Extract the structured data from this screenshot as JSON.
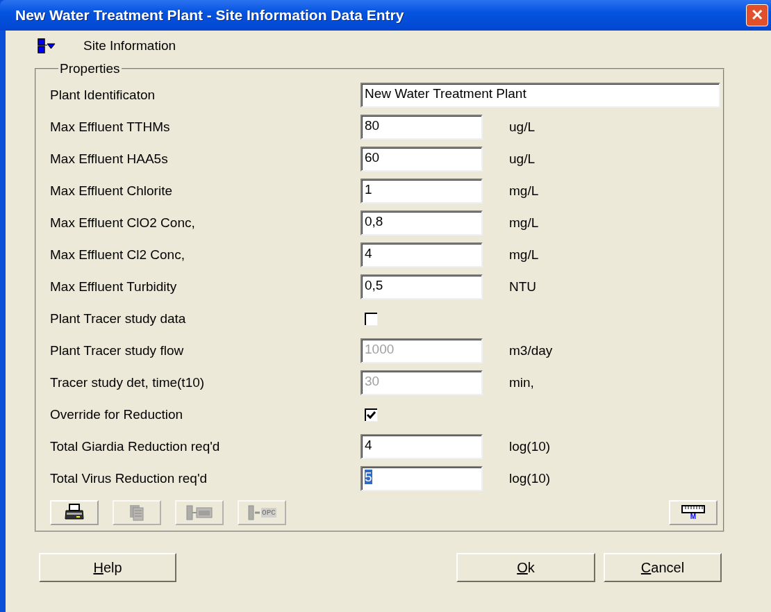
{
  "window": {
    "title": "New Water Treatment Plant - Site Information Data Entry",
    "close": "✕"
  },
  "header": {
    "label": "Site Information"
  },
  "group": {
    "title": "Properties"
  },
  "rows": [
    {
      "kind": "text",
      "label": "Plant Identificaton",
      "value": "New Water Treatment Plant",
      "disabled": false,
      "highlighted": false
    },
    {
      "kind": "text",
      "label": "Max Effluent TTHMs",
      "value": "80",
      "unit": "ug/L",
      "disabled": false,
      "highlighted": false
    },
    {
      "kind": "text",
      "label": "Max Effluent HAA5s",
      "value": "60",
      "unit": "ug/L",
      "disabled": false,
      "highlighted": false
    },
    {
      "kind": "text",
      "label": "Max Effluent Chlorite",
      "value": "1",
      "unit": "mg/L",
      "disabled": false,
      "highlighted": false
    },
    {
      "kind": "text",
      "label": "Max Effluent ClO2 Conc,",
      "value": "0,8",
      "unit": "mg/L",
      "disabled": false,
      "highlighted": false
    },
    {
      "kind": "text",
      "label": "Max Effluent Cl2 Conc,",
      "value": "4",
      "unit": "mg/L",
      "disabled": false,
      "highlighted": false
    },
    {
      "kind": "text",
      "label": "Max Effluent Turbidity",
      "value": "0,5",
      "unit": "NTU",
      "disabled": false,
      "highlighted": false
    },
    {
      "kind": "checkbox",
      "label": "Plant Tracer study data",
      "checked": false
    },
    {
      "kind": "text",
      "label": "Plant Tracer study flow",
      "value": "1000",
      "unit": "m3/day",
      "disabled": true,
      "highlighted": false
    },
    {
      "kind": "text",
      "label": "Tracer study det, time(t10)",
      "value": "30",
      "unit": "min,",
      "disabled": true,
      "highlighted": false
    },
    {
      "kind": "checkbox",
      "label": "Override for Reduction",
      "checked": true
    },
    {
      "kind": "text",
      "label": "Total Giardia Reduction req'd",
      "value": "4",
      "unit": "log(10)",
      "disabled": false,
      "highlighted": false
    },
    {
      "kind": "text",
      "label": "Total Virus Reduction req'd",
      "value": "5",
      "unit": "log(10)",
      "disabled": false,
      "highlighted": true
    }
  ],
  "toolbar": [
    {
      "kind": "print",
      "disabled": false
    },
    {
      "kind": "copy",
      "disabled": true
    },
    {
      "kind": "layout",
      "disabled": true
    },
    {
      "kind": "export",
      "label": "OPC",
      "disabled": true
    }
  ],
  "units_button": {
    "label": "M"
  },
  "buttons": [
    {
      "label": "Help"
    },
    {
      "label": "Ok"
    },
    {
      "label": "Cancel"
    }
  ]
}
